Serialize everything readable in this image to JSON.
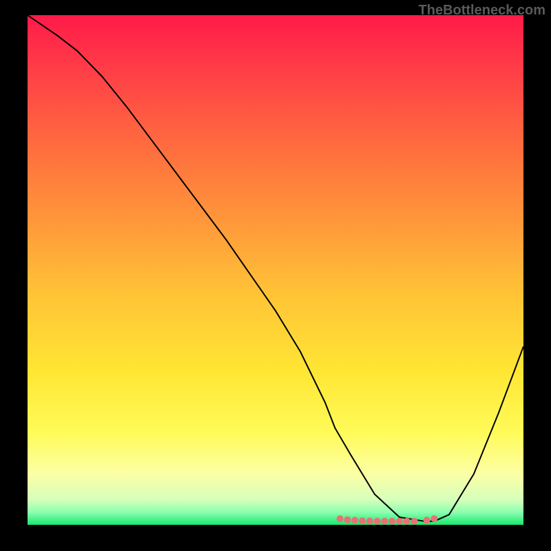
{
  "watermark": "TheBottleneck.com",
  "chart_data": {
    "type": "line",
    "title": "",
    "xlabel": "",
    "ylabel": "",
    "xlim": [
      0,
      100
    ],
    "ylim": [
      0,
      100
    ],
    "background_gradient": {
      "type": "vertical",
      "stops": [
        {
          "pos": 0.0,
          "color": "#ff1a49"
        },
        {
          "pos": 0.1,
          "color": "#ff3b47"
        },
        {
          "pos": 0.25,
          "color": "#ff6a3f"
        },
        {
          "pos": 0.4,
          "color": "#ff963a"
        },
        {
          "pos": 0.55,
          "color": "#ffc436"
        },
        {
          "pos": 0.7,
          "color": "#ffe634"
        },
        {
          "pos": 0.82,
          "color": "#fffb59"
        },
        {
          "pos": 0.9,
          "color": "#fcffa5"
        },
        {
          "pos": 0.95,
          "color": "#d7ffba"
        },
        {
          "pos": 0.975,
          "color": "#8dffb0"
        },
        {
          "pos": 1.0,
          "color": "#19e86f"
        }
      ]
    },
    "series": [
      {
        "name": "bottleneck-curve",
        "color": "#000000",
        "width": 2,
        "x": [
          0,
          3,
          6,
          10,
          15,
          20,
          25,
          30,
          35,
          40,
          45,
          50,
          55,
          60,
          62,
          65,
          70,
          75,
          80,
          82,
          85,
          90,
          95,
          100
        ],
        "y": [
          100,
          98,
          96,
          93,
          88,
          82,
          75.5,
          69,
          62.5,
          56,
          49,
          42,
          34,
          24,
          19,
          14,
          6,
          1.5,
          0.7,
          0.7,
          2,
          10,
          22,
          35
        ]
      }
    ],
    "markers": {
      "name": "valley-dots",
      "color": "#e57373",
      "radius": 5,
      "x": [
        63,
        64.5,
        66,
        67.5,
        69,
        70.5,
        72,
        73.5,
        75,
        76.5,
        78,
        80.5,
        82
      ],
      "y": [
        1.2,
        1.0,
        0.9,
        0.8,
        0.75,
        0.7,
        0.7,
        0.7,
        0.7,
        0.7,
        0.7,
        0.9,
        1.2
      ]
    }
  }
}
